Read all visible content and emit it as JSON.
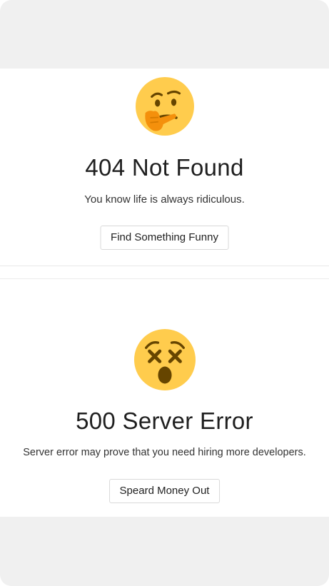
{
  "not_found": {
    "icon": "thinking-face-icon",
    "title": "404 Not Found",
    "description": "You know life is always ridiculous.",
    "button_label": "Find Something Funny"
  },
  "server_error": {
    "icon": "dizzy-face-icon",
    "title": "500 Server Error",
    "description": "Server error may prove that you need hiring more developers.",
    "button_label": "Speard Money Out"
  },
  "colors": {
    "emoji_face": "#FFCC4D",
    "emoji_features": "#664500",
    "hand": "#F4900C",
    "background": "#F0F0F0",
    "panel": "#FFFFFF"
  }
}
